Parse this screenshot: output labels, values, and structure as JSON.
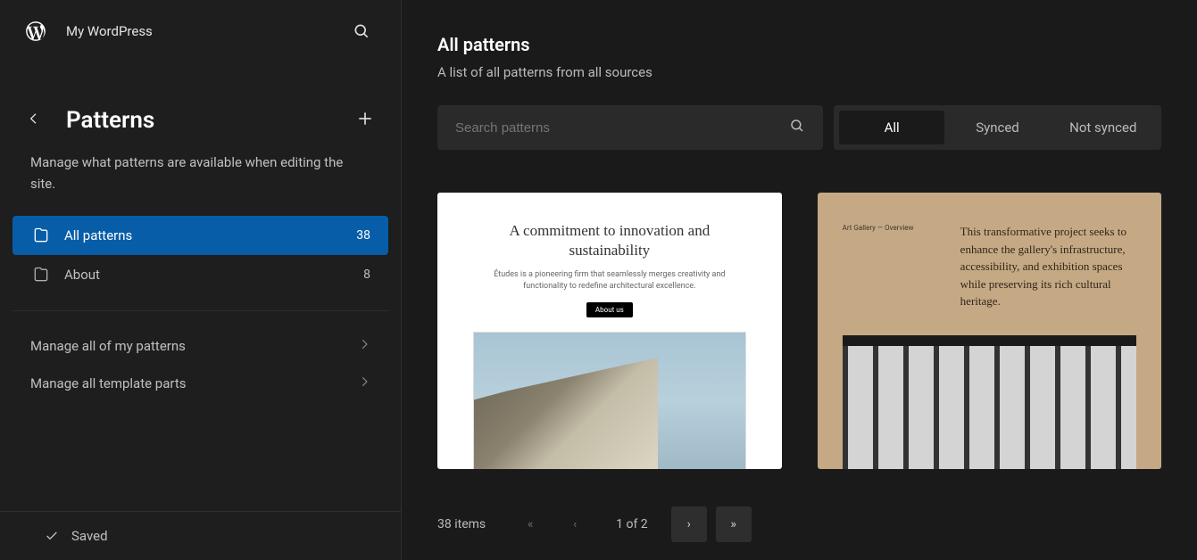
{
  "header": {
    "site_name": "My WordPress"
  },
  "sidebar": {
    "title": "Patterns",
    "description": "Manage what patterns are available when editing the site.",
    "items": [
      {
        "label": "All patterns",
        "count": "38"
      },
      {
        "label": "About",
        "count": "8"
      }
    ],
    "manage_links": [
      "Manage all of my patterns",
      "Manage all template parts"
    ],
    "footer_status": "Saved"
  },
  "main": {
    "title": "All patterns",
    "subtitle": "A list of all patterns from all sources",
    "search_placeholder": "Search patterns",
    "filters": [
      "All",
      "Synced",
      "Not synced"
    ],
    "patterns": [
      {
        "heading": "A commitment to innovation and sustainability",
        "sub": "Études is a pioneering firm that seamlessly merges creativity and functionality to redefine architectural excellence.",
        "button": "About us"
      },
      {
        "label": "Art Gallery — Overview",
        "body": "This transformative project seeks to enhance the gallery's infrastructure, accessibility, and exhibition spaces while preserving its rich cultural heritage."
      }
    ],
    "pagination": {
      "items_label": "38 items",
      "indicator": "1 of 2",
      "first": "«",
      "prev": "‹",
      "next": "›",
      "last": "»"
    }
  }
}
